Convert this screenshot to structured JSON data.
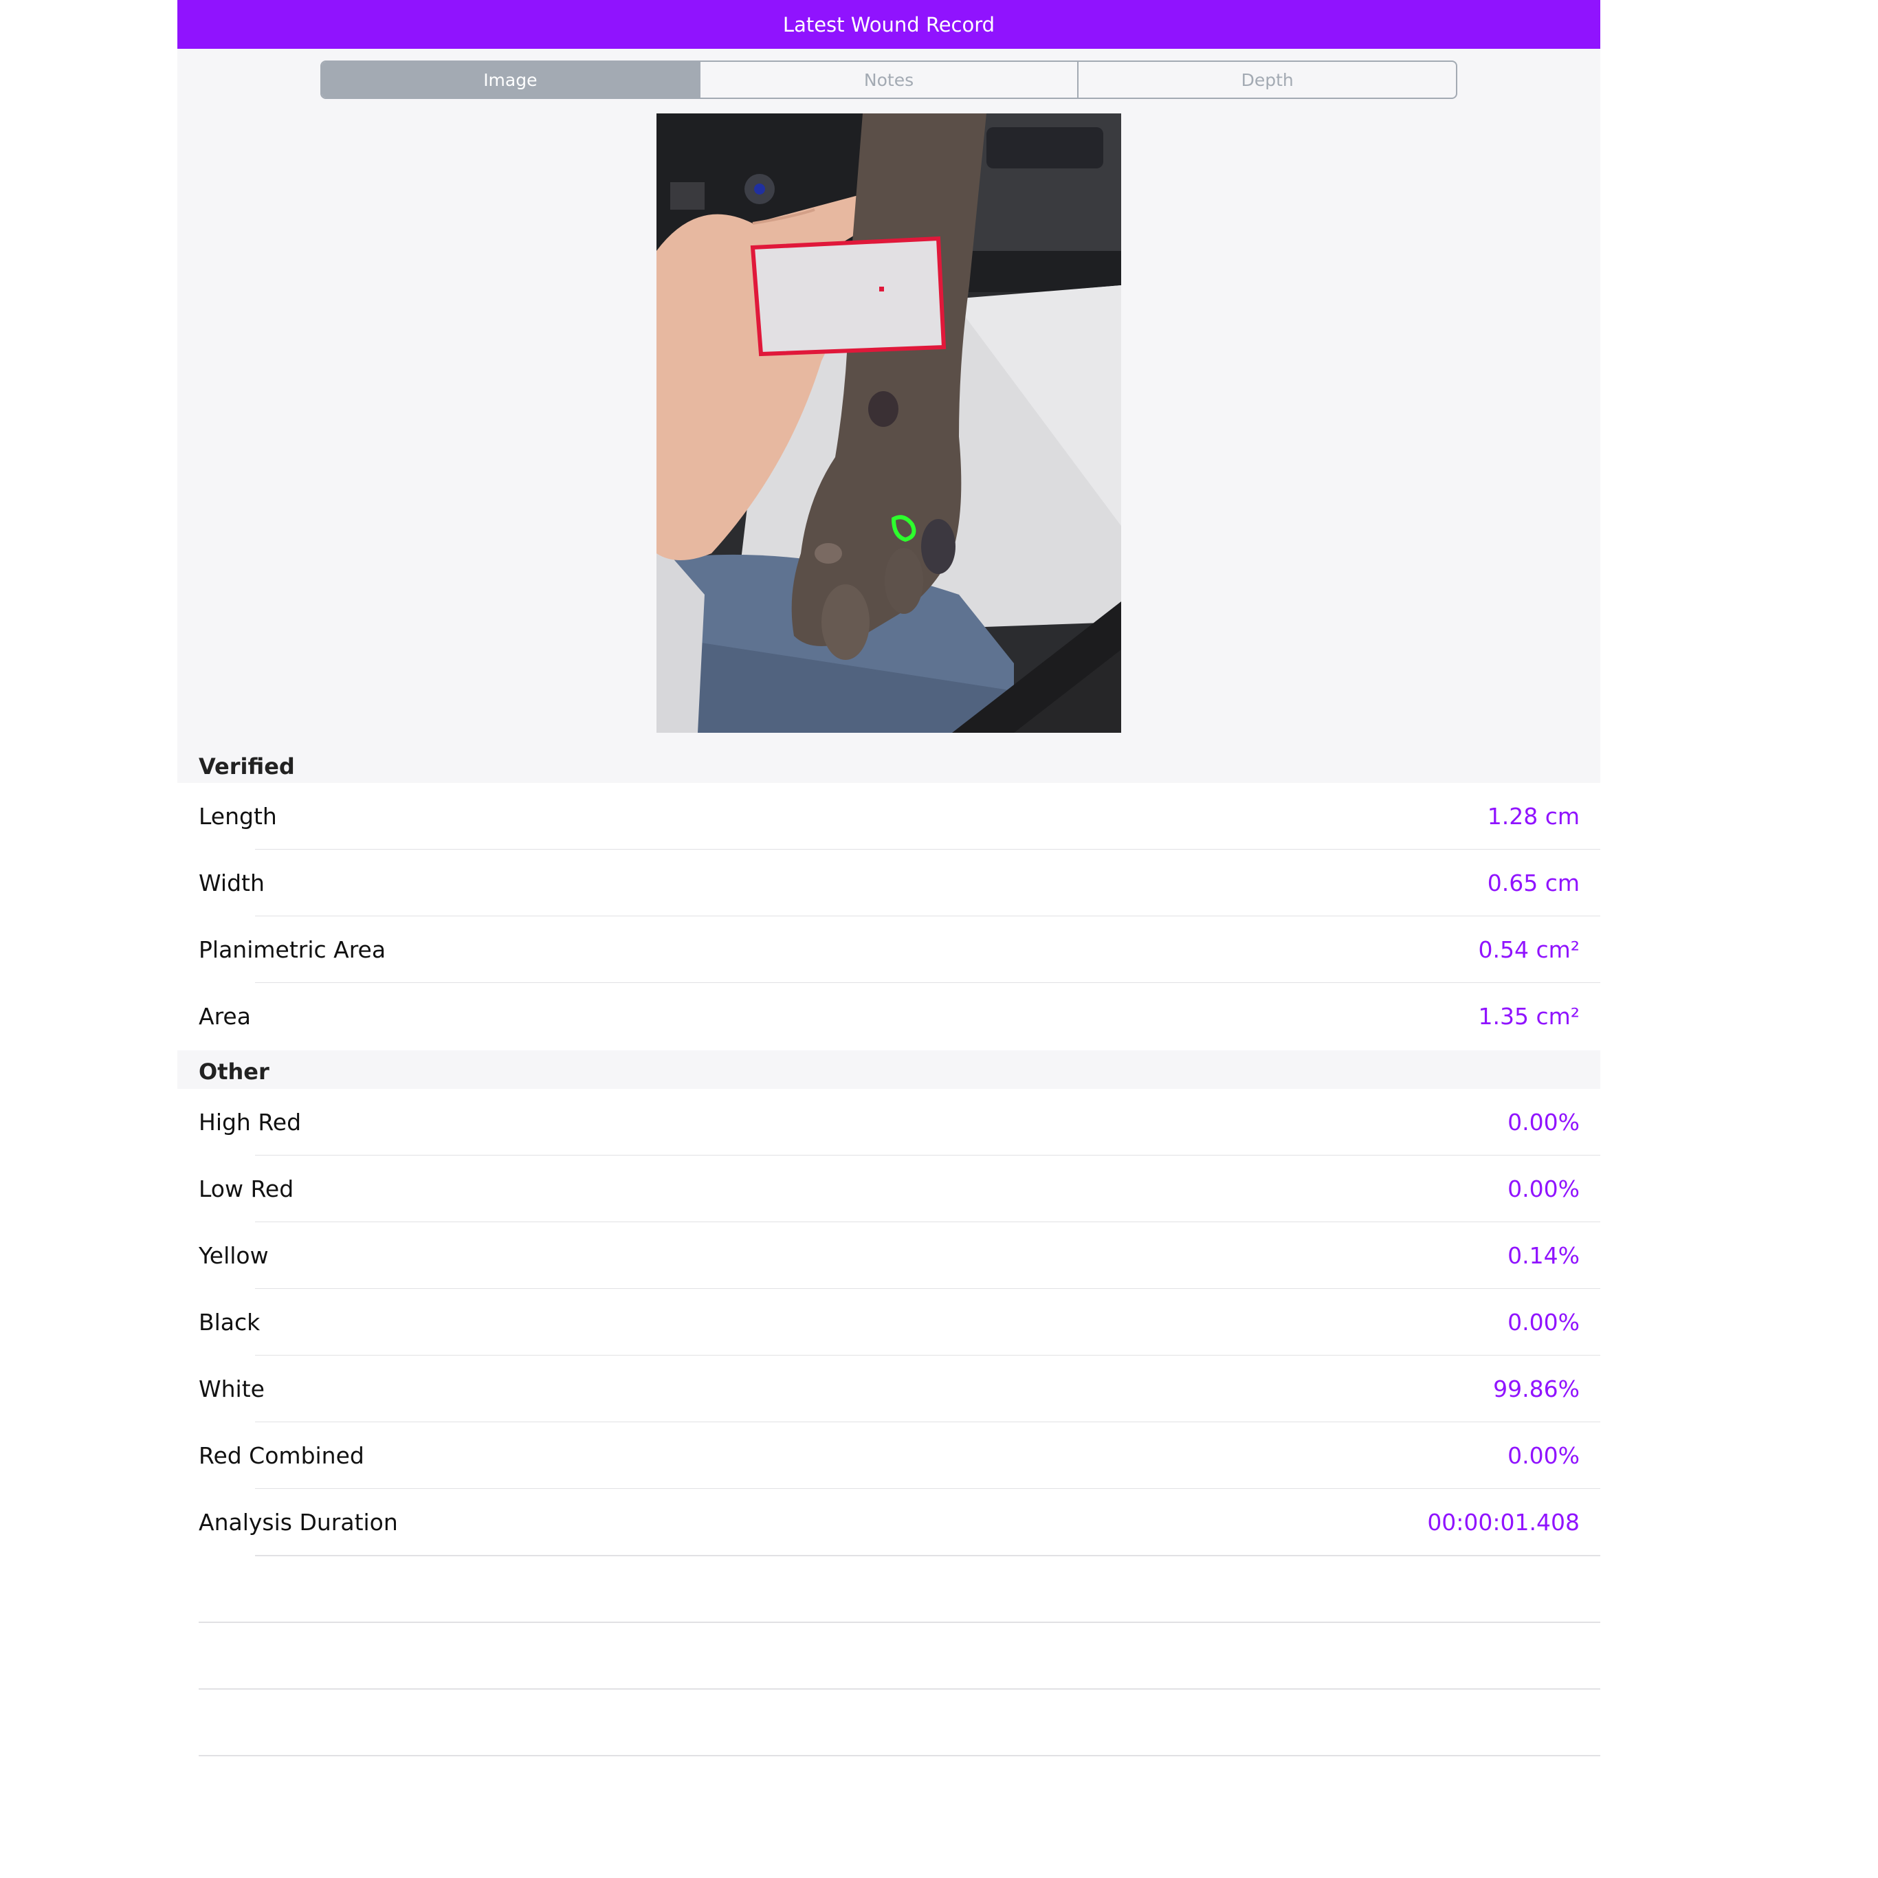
{
  "navbar": {
    "title": "Latest Wound Record",
    "bg_color": "#9013fe"
  },
  "tabs": [
    {
      "label": "Image",
      "selected": true
    },
    {
      "label": "Notes",
      "selected": false
    },
    {
      "label": "Depth",
      "selected": false
    }
  ],
  "photo": {
    "description_icon": "wound-photo-image"
  },
  "sections": {
    "verified": {
      "header": "Verified",
      "rows": [
        {
          "label": "Length",
          "value": "1.28 cm"
        },
        {
          "label": "Width",
          "value": "0.65 cm"
        },
        {
          "label": "Planimetric Area",
          "value": "0.54 cm²"
        },
        {
          "label": "Area",
          "value": "1.35 cm²"
        }
      ]
    },
    "other": {
      "header": "Other",
      "rows": [
        {
          "label": "High Red",
          "value": "0.00%"
        },
        {
          "label": "Low Red",
          "value": "0.00%"
        },
        {
          "label": "Yellow",
          "value": "0.14%"
        },
        {
          "label": "Black",
          "value": "0.00%"
        },
        {
          "label": "White",
          "value": "99.86%"
        },
        {
          "label": "Red Combined",
          "value": "0.00%"
        },
        {
          "label": "Analysis Duration",
          "value": "00:00:01.408"
        }
      ]
    }
  },
  "colors": {
    "accent": "#9013fe",
    "segment_gray": "#a3aab3"
  }
}
